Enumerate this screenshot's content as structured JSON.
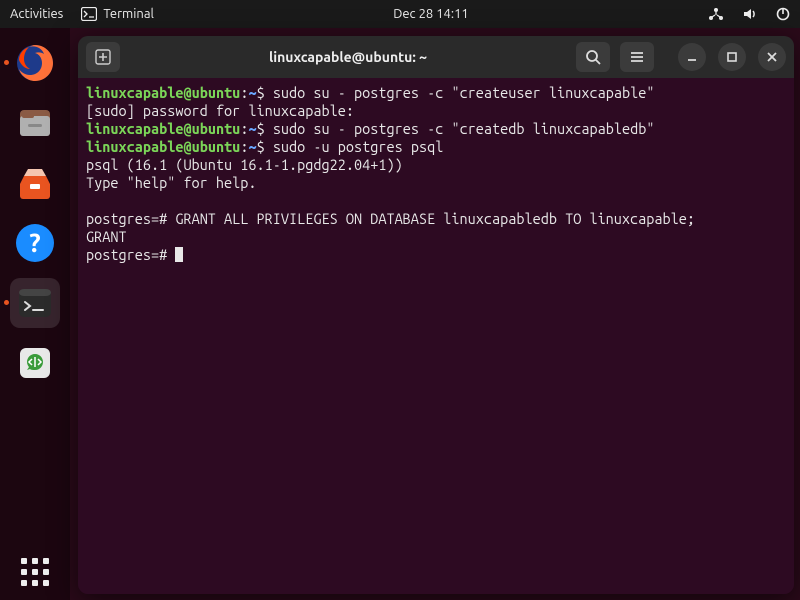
{
  "topbar": {
    "activities": "Activities",
    "app_indicator": "Terminal",
    "clock": "Dec 28  14:11"
  },
  "window": {
    "title": "linuxcapable@ubuntu: ~"
  },
  "prompt": {
    "user": "linuxcapable",
    "at": "@",
    "host": "ubuntu",
    "colon": ":",
    "path": "~",
    "sigil": "$ "
  },
  "lines": {
    "cmd1": "sudo su - postgres -c \"createuser linuxcapable\"",
    "sudo_pw": "[sudo] password for linuxcapable:",
    "cmd2": "sudo su - postgres -c \"createdb linuxcapabledb\"",
    "cmd3": "sudo -u postgres psql",
    "psql_ver": "psql (16.1 (Ubuntu 16.1-1.pgdg22.04+1))",
    "psql_help": "Type \"help\" for help.",
    "psql_prompt": "postgres=# ",
    "grant": "GRANT ALL PRIVILEGES ON DATABASE linuxcapabledb TO linuxcapable;",
    "grant_ok": "GRANT"
  }
}
